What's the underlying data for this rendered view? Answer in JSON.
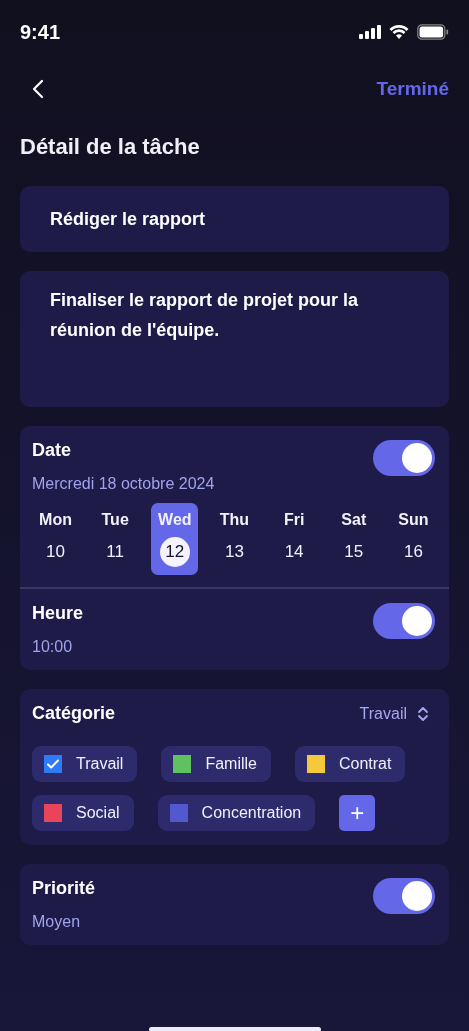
{
  "status_bar": {
    "time": "9:41"
  },
  "nav": {
    "done": "Terminé"
  },
  "title": "Détail de la tâche",
  "task": {
    "name": "Rédiger le rapport",
    "description": "Finaliser le rapport de projet pour la réunion de l'équipe."
  },
  "date": {
    "label": "Date",
    "on": true,
    "value": "Mercredi 18 octobre 2024",
    "days": [
      {
        "name": "Mon",
        "number": "10",
        "selected": false
      },
      {
        "name": "Tue",
        "number": "11",
        "selected": false
      },
      {
        "name": "Wed",
        "number": "12",
        "selected": true
      },
      {
        "name": "Thu",
        "number": "13",
        "selected": false
      },
      {
        "name": "Fri",
        "number": "14",
        "selected": false
      },
      {
        "name": "Sat",
        "number": "15",
        "selected": false
      },
      {
        "name": "Sun",
        "number": "16",
        "selected": false
      }
    ]
  },
  "time": {
    "label": "Heure",
    "on": true,
    "value": "10:00"
  },
  "category": {
    "label": "Catégorie",
    "current": "Travail",
    "chips": [
      {
        "label": "Travail",
        "color": "#2f7bf5",
        "checked": true
      },
      {
        "label": "Famille",
        "color": "#5fc15f",
        "checked": false
      },
      {
        "label": "Contrat",
        "color": "#f5c93c",
        "checked": false
      },
      {
        "label": "Social",
        "color": "#e9445a",
        "checked": false
      },
      {
        "label": "Concentration",
        "color": "#5458d0",
        "checked": false
      }
    ],
    "add": "+"
  },
  "priority": {
    "label": "Priorité",
    "on": true,
    "value": "Moyen"
  }
}
